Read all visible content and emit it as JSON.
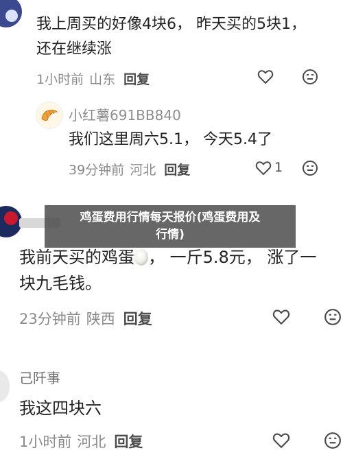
{
  "comments": [
    {
      "line1": "我上周买的好像4块6， 昨天买的5块1，",
      "line2": "还在继续涨",
      "time": "1小时前",
      "location": "山东",
      "reply": "回复",
      "icons": [
        "heart-outline-icon",
        "neutral-face-icon"
      ]
    },
    {
      "username": "小红薯691BB840",
      "text": "我们这里周六5.1， 今天5.4了",
      "time": "39分钟前",
      "location": "河北",
      "reply": "回复",
      "like_count": "1",
      "icons": [
        "heart-outline-icon",
        "neutral-face-icon"
      ]
    },
    {
      "line1_before": "我前天买的鸡蛋",
      "line1_after": "， 一斤5.8元， 涨了一",
      "line2": "块九毛钱。",
      "time": "23分钟前",
      "location": "陕西",
      "reply": "回复",
      "icons": [
        "egg-emoji",
        "heart-outline-icon",
        "neutral-face-icon"
      ]
    },
    {
      "username": "己阡事",
      "text": "我这四块六",
      "time": "1小时前",
      "location": "河北",
      "reply": "回复",
      "icons": [
        "heart-outline-icon",
        "neutral-face-icon"
      ]
    }
  ],
  "banner": {
    "line1": "鸡蛋费用行情每天报价(鸡蛋费用及",
    "line2": "行情)"
  },
  "colors": {
    "meta_text": "#8a8a8a",
    "reply_text": "#4a4a4a",
    "banner_bg": "#464646"
  }
}
